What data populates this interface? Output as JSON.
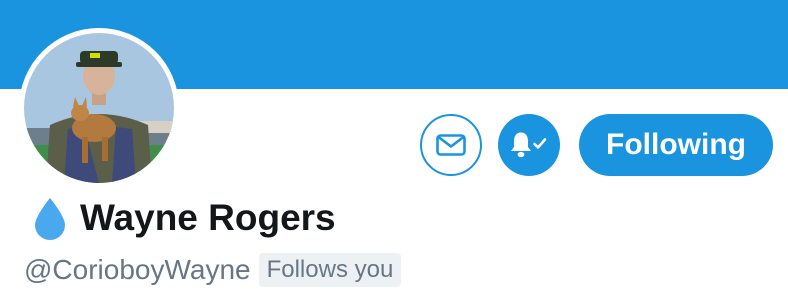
{
  "profile": {
    "display_name": "Wayne Rogers",
    "handle": "@CorioboyWayne",
    "follows_you_badge": "Follows you"
  },
  "actions": {
    "following_label": "Following",
    "message_icon": "envelope-icon",
    "notify_icon": "bell-check-icon"
  },
  "colors": {
    "accent": "#1b94e0",
    "drop_icon": "#4aa8ee",
    "name_text": "#14171a",
    "secondary_text": "#657786"
  }
}
